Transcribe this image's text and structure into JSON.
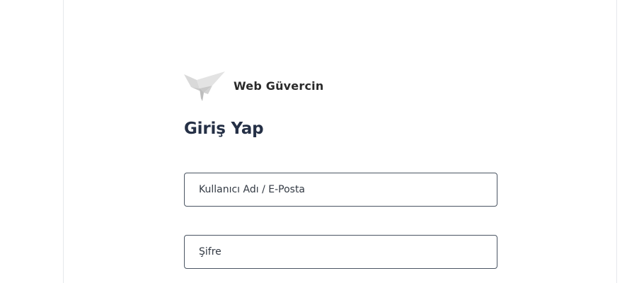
{
  "brand": {
    "name": "Web Güvercin",
    "logo_icon": "origami-dove-icon"
  },
  "login": {
    "title": "Giriş Yap",
    "username_placeholder": "Kullanıcı Adı / E-Posta",
    "username_value": "",
    "password_placeholder": "Şifre",
    "password_value": ""
  },
  "colors": {
    "title": "#253046",
    "input_border": "#4b5563",
    "panel_border": "#e6e8ec"
  }
}
